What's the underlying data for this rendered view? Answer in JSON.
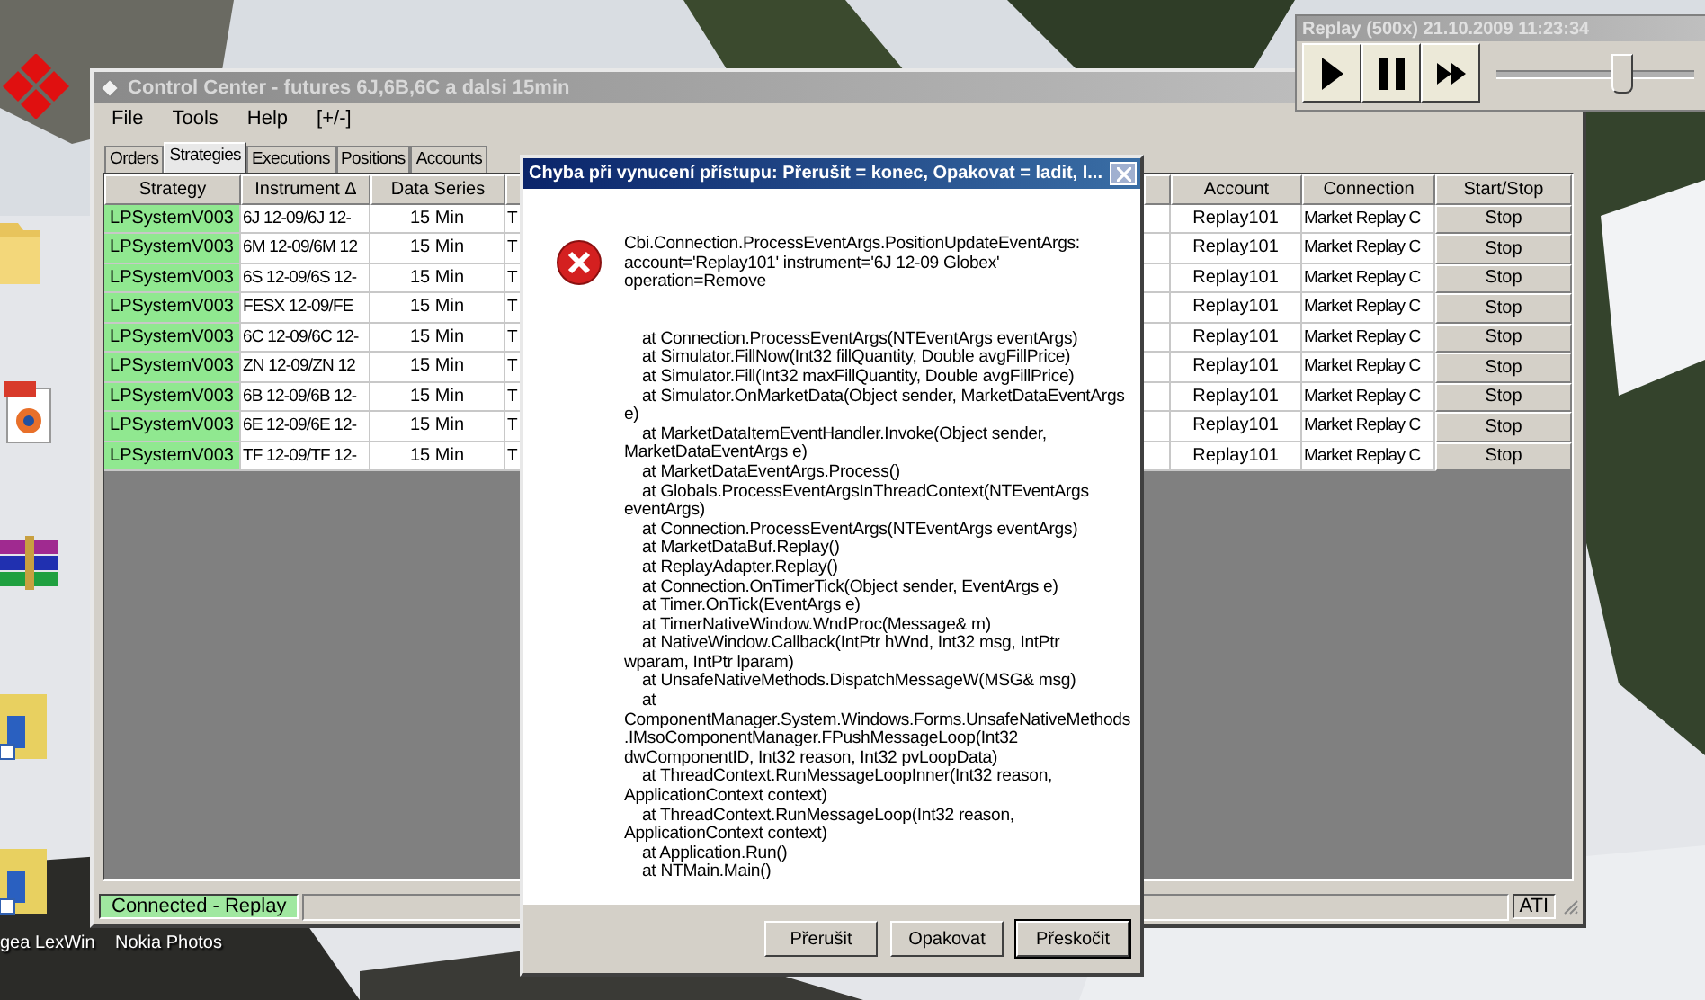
{
  "desktop": {
    "labels": [
      "gea LexWin",
      "Nokia Photos"
    ]
  },
  "main_window": {
    "title": "Control Center - futures 6J,6B,6C a dalsi 15min",
    "menu": [
      "File",
      "Tools",
      "Help",
      "[+/-]"
    ],
    "tabs": [
      {
        "label": "Orders",
        "selected": false
      },
      {
        "label": "Strategies",
        "selected": true
      },
      {
        "label": "Executions",
        "selected": false
      },
      {
        "label": "Positions",
        "selected": false
      },
      {
        "label": "Accounts",
        "selected": false
      }
    ],
    "table": {
      "columns": [
        "Strategy",
        "Instrument Δ",
        "Data Series"
      ],
      "right_columns": [
        "Account",
        "Connection",
        "Start/Stop"
      ],
      "rows": [
        {
          "strategy": "LPSystemV003",
          "enabled": true,
          "instrument": "6J 12-09/6J 12-",
          "data_series": "15 Min",
          "column_4": "T",
          "account": "Replay101",
          "connection": "Market Replay C",
          "action": "Stop"
        },
        {
          "strategy": "LPSystemV003",
          "enabled": true,
          "instrument": "6M 12-09/6M 12",
          "data_series": "15 Min",
          "column_4": "T",
          "account": "Replay101",
          "connection": "Market Replay C",
          "action": "Stop"
        },
        {
          "strategy": "LPSystemV003",
          "enabled": true,
          "instrument": "6S 12-09/6S 12-",
          "data_series": "15 Min",
          "column_4": "T",
          "account": "Replay101",
          "connection": "Market Replay C",
          "action": "Stop"
        },
        {
          "strategy": "LPSystemV003",
          "enabled": true,
          "instrument": "FESX 12-09/FE",
          "data_series": "15 Min",
          "column_4": "T",
          "account": "Replay101",
          "connection": "Market Replay C",
          "action": "Stop"
        },
        {
          "strategy": "LPSystemV003",
          "enabled": true,
          "instrument": "6C 12-09/6C 12-",
          "data_series": "15 Min",
          "column_4": "T",
          "account": "Replay101",
          "connection": "Market Replay C",
          "action": "Stop"
        },
        {
          "strategy": "LPSystemV003",
          "enabled": true,
          "instrument": "ZN 12-09/ZN 12",
          "data_series": "15 Min",
          "column_4": "T",
          "account": "Replay101",
          "connection": "Market Replay C",
          "action": "Stop"
        },
        {
          "strategy": "LPSystemV003",
          "enabled": true,
          "instrument": "6B 12-09/6B 12-",
          "data_series": "15 Min",
          "column_4": "T",
          "account": "Replay101",
          "connection": "Market Replay C",
          "action": "Stop"
        },
        {
          "strategy": "LPSystemV003",
          "enabled": true,
          "instrument": "6E 12-09/6E 12-",
          "data_series": "15 Min",
          "column_4": "T",
          "account": "Replay101",
          "connection": "Market Replay C",
          "action": "Stop"
        },
        {
          "strategy": "LPSystemV003",
          "enabled": true,
          "instrument": "TF 12-09/TF 12-",
          "data_series": "15 Min",
          "column_4": "T",
          "account": "Replay101",
          "connection": "Market Replay C",
          "action": "Stop"
        }
      ]
    },
    "status_bar": {
      "connection": "Connected - Replay",
      "connected": true,
      "right": "ATI"
    }
  },
  "replay_toolbar": {
    "title": "Replay (500x) 21.10.2009 11:23:34",
    "speed": {
      "level": 0.63
    }
  },
  "dialog": {
    "title": "Chyba při vynucení přístupu: Přerušit = konec, Opakovat = ladit, I...",
    "header_lines": [
      "Cbi.Connection.ProcessEventArgs.PositionUpdateEventArgs:",
      "account='Replay101' instrument='6J 12-09 Globex'",
      "operation=Remove"
    ],
    "trace": [
      {
        "text": "at Connection.ProcessEventArgs(NTEventArgs eventArgs)",
        "indent": true
      },
      {
        "text": "at Simulator.FillNow(Int32 fillQuantity, Double avgFillPrice)",
        "indent": true
      },
      {
        "text": "at Simulator.Fill(Int32 maxFillQuantity, Double avgFillPrice)",
        "indent": true
      },
      {
        "text": "at Simulator.OnMarketData(Object sender, MarketDataEventArgs",
        "indent": true
      },
      {
        "text": "e)",
        "indent": false
      },
      {
        "text": "at MarketDataItemEventHandler.Invoke(Object sender,",
        "indent": true
      },
      {
        "text": "MarketDataEventArgs e)",
        "indent": false
      },
      {
        "text": "at MarketDataEventArgs.Process()",
        "indent": true
      },
      {
        "text": "at Globals.ProcessEventArgsInThreadContext(NTEventArgs",
        "indent": true
      },
      {
        "text": "eventArgs)",
        "indent": false
      },
      {
        "text": "at Connection.ProcessEventArgs(NTEventArgs eventArgs)",
        "indent": true
      },
      {
        "text": "at MarketDataBuf.Replay()",
        "indent": true
      },
      {
        "text": "at ReplayAdapter.Replay()",
        "indent": true
      },
      {
        "text": "at Connection.OnTimerTick(Object sender, EventArgs e)",
        "indent": true
      },
      {
        "text": "at Timer.OnTick(EventArgs e)",
        "indent": true
      },
      {
        "text": "at TimerNativeWindow.WndProc(Message& m)",
        "indent": true
      },
      {
        "text": "at NativeWindow.Callback(IntPtr hWnd, Int32 msg, IntPtr",
        "indent": true
      },
      {
        "text": "wparam, IntPtr lparam)",
        "indent": false
      },
      {
        "text": "at UnsafeNativeMethods.DispatchMessageW(MSG& msg)",
        "indent": true
      },
      {
        "text": "at",
        "indent": true
      },
      {
        "text": "ComponentManager.System.Windows.Forms.UnsafeNativeMethods",
        "indent": false
      },
      {
        "text": ".IMsoComponentManager.FPushMessageLoop(Int32",
        "indent": false
      },
      {
        "text": "dwComponentID, Int32 reason, Int32 pvLoopData)",
        "indent": false
      },
      {
        "text": "at ThreadContext.RunMessageLoopInner(Int32 reason,",
        "indent": true
      },
      {
        "text": "ApplicationContext context)",
        "indent": false
      },
      {
        "text": "at ThreadContext.RunMessageLoop(Int32 reason,",
        "indent": true
      },
      {
        "text": "ApplicationContext context)",
        "indent": false
      },
      {
        "text": "at Application.Run()",
        "indent": true
      },
      {
        "text": "at NTMain.Main()",
        "indent": true
      }
    ],
    "buttons": [
      {
        "label": "Přerušit",
        "default": false
      },
      {
        "label": "Opakovat",
        "default": false
      },
      {
        "label": "Přeskočit",
        "default": true
      }
    ]
  }
}
